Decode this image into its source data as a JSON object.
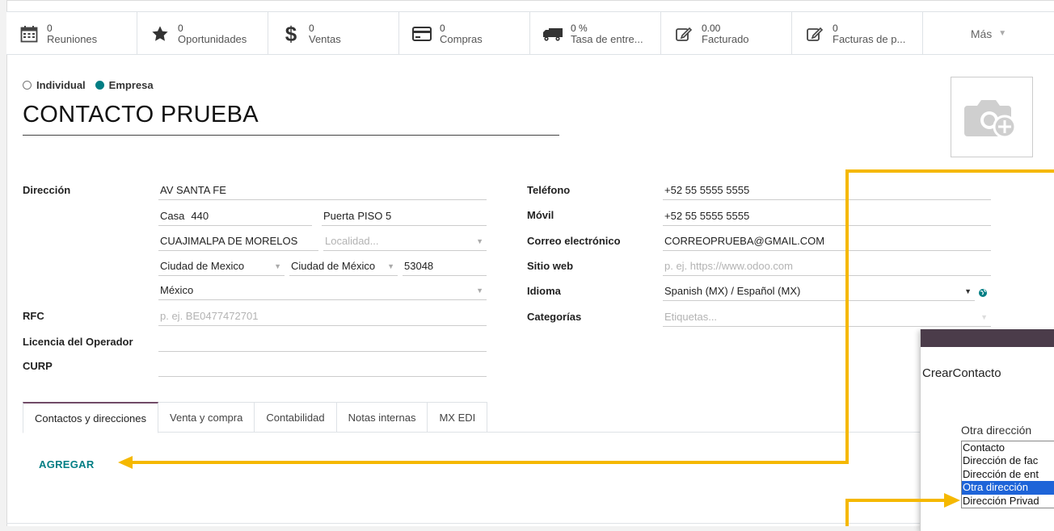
{
  "smart_buttons": [
    {
      "icon": "calendar-icon",
      "value": "0",
      "label": "Reuniones"
    },
    {
      "icon": "star-icon",
      "value": "0",
      "label": "Oportunidades"
    },
    {
      "icon": "dollar-icon",
      "value": "0",
      "label": "Ventas"
    },
    {
      "icon": "credit-card-icon",
      "value": "0",
      "label": "Compras"
    },
    {
      "icon": "truck-icon",
      "value": "0 %",
      "label": "Tasa de entre..."
    },
    {
      "icon": "edit-icon",
      "value": "0.00",
      "label": "Facturado"
    },
    {
      "icon": "edit-icon",
      "value": "0",
      "label": "Facturas de p..."
    }
  ],
  "more_label": "Más",
  "company_type": {
    "individual": "Individual",
    "company": "Empresa",
    "selected": "Empresa"
  },
  "name": "CONTACTO PRUEBA",
  "left": {
    "address_label": "Dirección",
    "street": "AV SANTA FE",
    "street2_prefix": "Casa",
    "street_number": "440",
    "door_prefix": "Puerta",
    "door": "PISO 5",
    "city": "CUAJIMALPA DE MORELOS",
    "locality_placeholder": "Localidad...",
    "municipality": "Ciudad de Mexico",
    "state": "Ciudad de México",
    "zip": "53048",
    "country": "México",
    "rfc_label": "RFC",
    "rfc_placeholder": "p. ej. BE0477472701",
    "license_label": "Licencia del Operador",
    "curp_label": "CURP"
  },
  "right": {
    "phone_label": "Teléfono",
    "phone": "+52 55 5555 5555",
    "mobile_label": "Móvil",
    "mobile": "+52 55 5555 5555",
    "email_label": "Correo electrónico",
    "email": "CORREOPRUEBA@GMAIL.COM",
    "website_label": "Sitio web",
    "website_placeholder": "p. ej. https://www.odoo.com",
    "language_label": "Idioma",
    "language": "Spanish (MX) / Español (MX)",
    "tags_label": "Categorías",
    "tags_placeholder": "Etiquetas..."
  },
  "tabs": [
    "Contactos y direcciones",
    "Venta y compra",
    "Contabilidad",
    "Notas internas",
    "MX EDI"
  ],
  "add_button": "AGREGAR",
  "popup": {
    "title": "CrearContacto",
    "field_label": "Otra dirección",
    "options": [
      "Contacto",
      "Dirección de fac",
      "Dirección de ent",
      "Otra dirección",
      "Dirección Privad"
    ],
    "selected": "Otra dirección"
  },
  "colors": {
    "accent": "#017e84",
    "arrow": "#f5b800",
    "tab_active": "#714b67",
    "select_blue": "#1e64d8"
  }
}
